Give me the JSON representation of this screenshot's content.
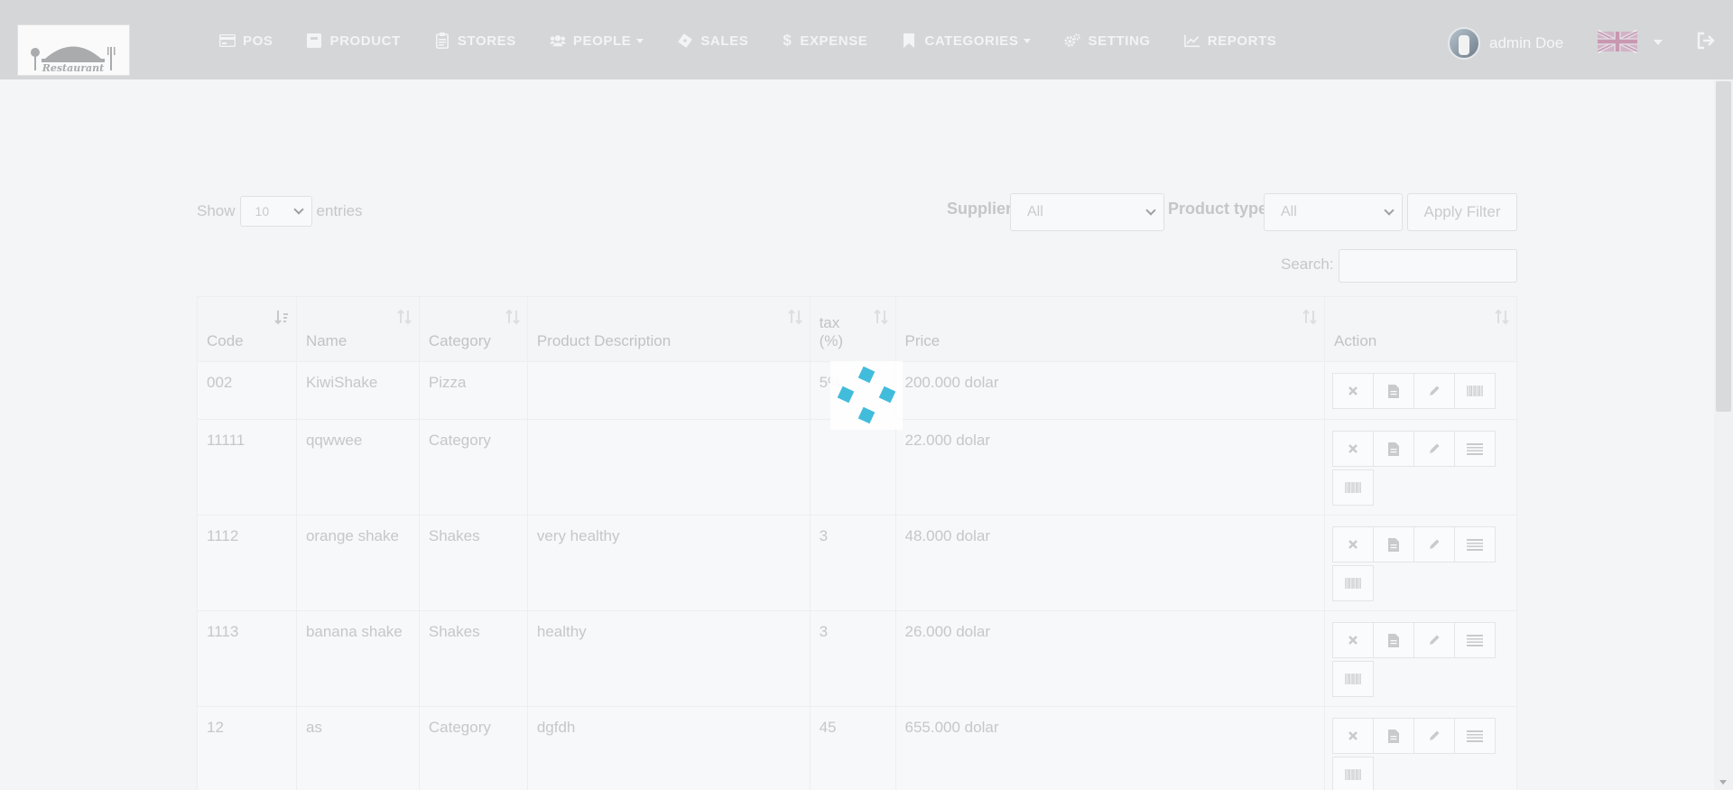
{
  "navbar": {
    "logo_text": "Restaurant",
    "items": [
      {
        "label": "POS",
        "icon": "credit-card-icon",
        "dropdown": false
      },
      {
        "label": "PRODUCT",
        "icon": "archive-icon",
        "dropdown": false
      },
      {
        "label": "STORES",
        "icon": "clipboard-icon",
        "dropdown": false
      },
      {
        "label": "PEOPLE",
        "icon": "users-icon",
        "dropdown": true
      },
      {
        "label": "SALES",
        "icon": "ticket-icon",
        "dropdown": false
      },
      {
        "label": "EXPENSE",
        "icon": "dollar-icon",
        "dropdown": false
      },
      {
        "label": "CATEGORIES",
        "icon": "bookmark-icon",
        "dropdown": true
      },
      {
        "label": "SETTING",
        "icon": "cogs-icon",
        "dropdown": false
      },
      {
        "label": "REPORTS",
        "icon": "line-chart-icon",
        "dropdown": false
      }
    ],
    "user_name": "admin Doe",
    "language": "English"
  },
  "controls": {
    "show_label": "Show",
    "entries_value": "10",
    "entries_label": "entries",
    "supplier_label": "Supplier",
    "supplier_value": "All",
    "product_type_label": "Product type",
    "product_type_value": "All",
    "apply_filter_label": "Apply Filter",
    "search_label": "Search:",
    "search_value": ""
  },
  "table": {
    "columns": [
      "Code",
      "Name",
      "Category",
      "Product Description",
      "tax (%)",
      "Price",
      "Action"
    ],
    "tax_header_line1": "tax",
    "tax_header_line2": "(%)",
    "rows": [
      {
        "code": "002",
        "name": "KiwiShake",
        "category": "Pizza",
        "description": "",
        "tax": "5%",
        "price": "200.000 dolar"
      },
      {
        "code": "11111",
        "name": "qqwwee",
        "category": "Category",
        "description": "",
        "tax": "",
        "price": "22.000 dolar"
      },
      {
        "code": "1112",
        "name": "orange shake",
        "category": "Shakes",
        "description": "very healthy",
        "tax": "3",
        "price": "48.000 dolar"
      },
      {
        "code": "1113",
        "name": "banana shake",
        "category": "Shakes",
        "description": "healthy",
        "tax": "3",
        "price": "26.000 dolar"
      },
      {
        "code": "12",
        "name": "as",
        "category": "Category",
        "description": "dgfdh",
        "tax": "45",
        "price": "655.000 dolar"
      }
    ]
  },
  "colors": {
    "spinner": "#2fb6d8",
    "navbar_bg": "#d4d6d8",
    "page_bg": "#f4f5f6"
  }
}
